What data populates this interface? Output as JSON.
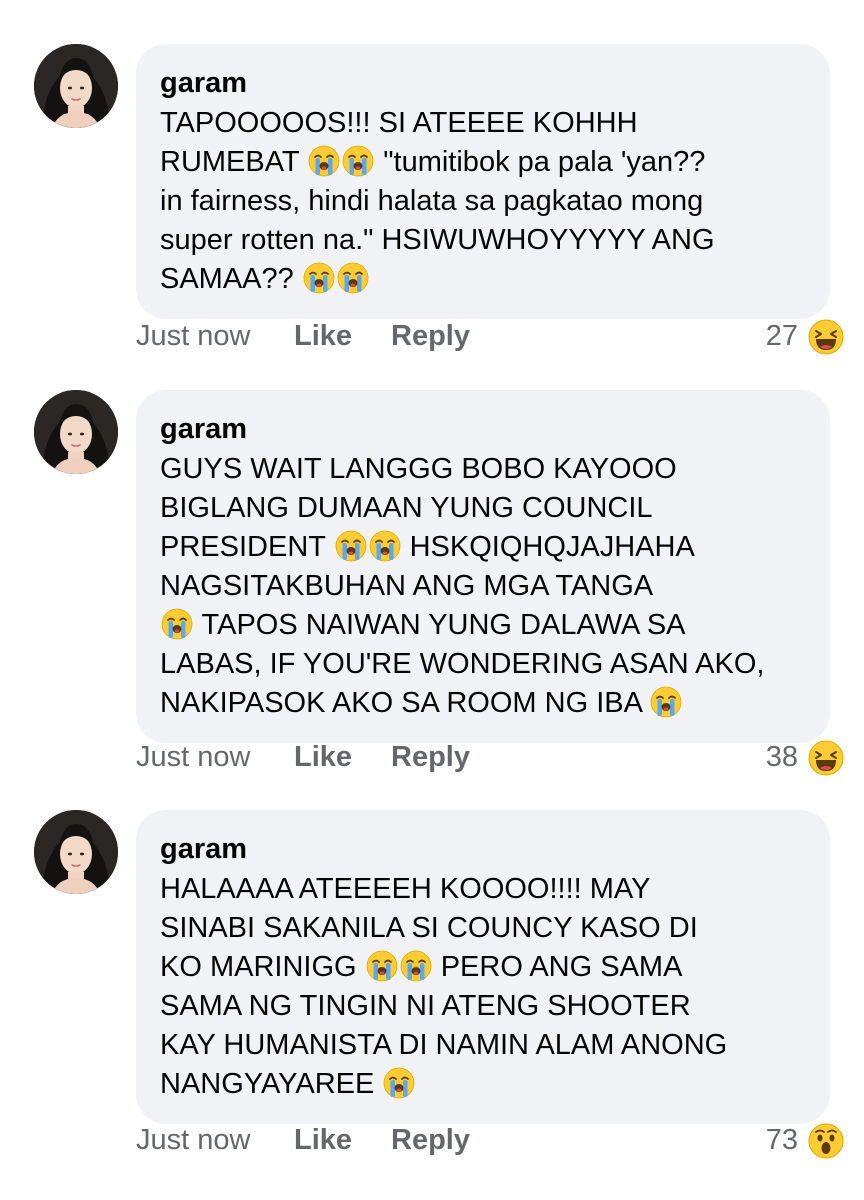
{
  "comments": [
    {
      "author": "garam",
      "lines": [
        [
          {
            "t": "TAPOOOOOS!!! SI ATEEEE KOHHH"
          }
        ],
        [
          {
            "t": "RUMEBAT "
          },
          {
            "e": "sob"
          },
          {
            "e": "sob"
          },
          {
            "t": " \"tumitibok pa pala 'yan??"
          }
        ],
        [
          {
            "t": "in fairness, hindi halata sa pagkatao mong"
          }
        ],
        [
          {
            "t": "super rotten na.\" HSIWUWHOYYYYY ANG"
          }
        ],
        [
          {
            "t": "SAMAA?? "
          },
          {
            "e": "sob"
          },
          {
            "e": "sob"
          }
        ]
      ],
      "time": "Just now",
      "like": "Like",
      "reply": "Reply",
      "reaction_count": "27",
      "reaction": "haha"
    },
    {
      "author": "garam",
      "lines": [
        [
          {
            "t": "GUYS WAIT LANGGG BOBO KAYOOO"
          }
        ],
        [
          {
            "t": "BIGLANG DUMAAN YUNG COUNCIL"
          }
        ],
        [
          {
            "t": "PRESIDENT "
          },
          {
            "e": "sob"
          },
          {
            "e": "sob"
          },
          {
            "t": " HSKQIQHQJAJHAHA"
          }
        ],
        [
          {
            "t": "NAGSITAKBUHAN ANG MGA TANGA"
          }
        ],
        [
          {
            "e": "sob"
          },
          {
            "t": " TAPOS NAIWAN YUNG DALAWA SA"
          }
        ],
        [
          {
            "t": "LABAS, IF YOU'RE WONDERING ASAN AKO,"
          }
        ],
        [
          {
            "t": "NAKIPASOK AKO SA ROOM NG IBA "
          },
          {
            "e": "sob"
          }
        ]
      ],
      "time": "Just now",
      "like": "Like",
      "reply": "Reply",
      "reaction_count": "38",
      "reaction": "haha"
    },
    {
      "author": "garam",
      "lines": [
        [
          {
            "t": "HALAAAA ATEEEEH KOOOO!!!! MAY"
          }
        ],
        [
          {
            "t": "SINABI SAKANILA SI COUNCY KASO DI"
          }
        ],
        [
          {
            "t": "KO MARINIGG "
          },
          {
            "e": "sob"
          },
          {
            "e": "sob"
          },
          {
            "t": " PERO ANG SAMA"
          }
        ],
        [
          {
            "t": "SAMA NG TINGIN NI ATENG SHOOTER"
          }
        ],
        [
          {
            "t": "KAY HUMANISTA DI NAMIN ALAM ANONG"
          }
        ],
        [
          {
            "t": "NANGYAYAREE "
          },
          {
            "e": "sob"
          }
        ]
      ],
      "time": "Just now",
      "like": "Like",
      "reply": "Reply",
      "reaction_count": "73",
      "reaction": "wow"
    }
  ],
  "colors": {
    "bubble": "#f0f2f5",
    "meta": "#65676b",
    "text": "#050505",
    "emoji_face": "#ffcc33"
  }
}
